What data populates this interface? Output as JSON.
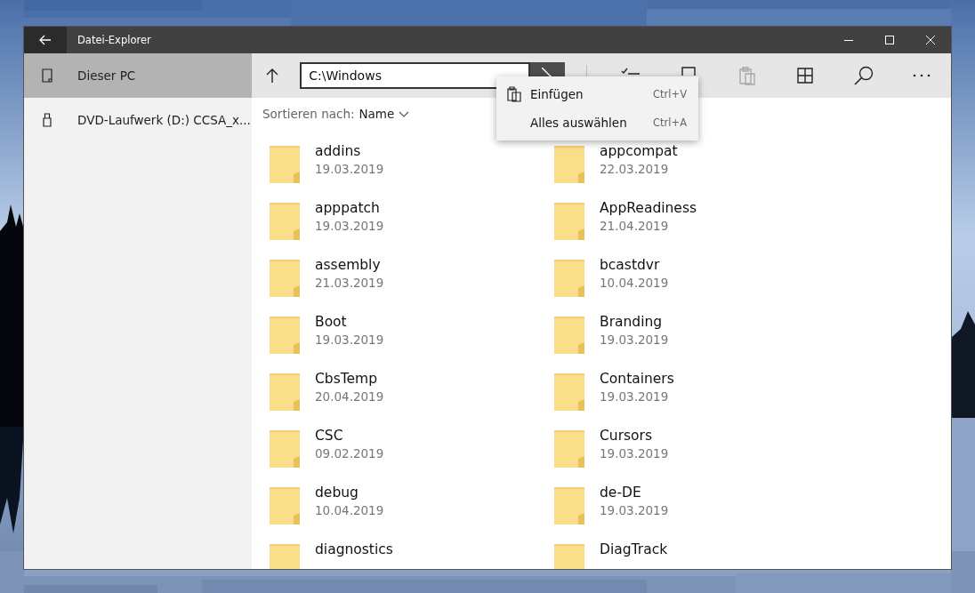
{
  "window": {
    "title": "Datei-Explorer"
  },
  "sidebar": {
    "items": [
      {
        "label": "Dieser PC",
        "kind": "pc",
        "selected": true
      },
      {
        "label": "DVD-Laufwerk (D:) CCSA_x...",
        "kind": "usb",
        "selected": false
      }
    ]
  },
  "address_bar": {
    "value": "C:\\Windows"
  },
  "toolbar": [
    {
      "kind": "select",
      "disabled": false
    },
    {
      "kind": "device",
      "disabled": false
    },
    {
      "kind": "paste",
      "disabled": true
    },
    {
      "kind": "grid",
      "disabled": false
    },
    {
      "kind": "search",
      "disabled": false
    },
    {
      "kind": "more",
      "disabled": false
    }
  ],
  "sort": {
    "label": "Sortieren nach:",
    "value": "Name"
  },
  "context_menu": [
    {
      "label": "Einfügen",
      "shortcut": "Ctrl+V",
      "kind": "paste"
    },
    {
      "label": "Alles auswählen",
      "shortcut": "Ctrl+A",
      "kind": "none"
    }
  ],
  "folders": [
    {
      "name": "addins",
      "date": "19.03.2019"
    },
    {
      "name": "appcompat",
      "date": "22.03.2019"
    },
    {
      "name": "apppatch",
      "date": "19.03.2019"
    },
    {
      "name": "AppReadiness",
      "date": "21.04.2019"
    },
    {
      "name": "assembly",
      "date": "21.03.2019"
    },
    {
      "name": "bcastdvr",
      "date": "10.04.2019"
    },
    {
      "name": "Boot",
      "date": "19.03.2019"
    },
    {
      "name": "Branding",
      "date": "19.03.2019"
    },
    {
      "name": "CbsTemp",
      "date": "20.04.2019"
    },
    {
      "name": "Containers",
      "date": "19.03.2019"
    },
    {
      "name": "CSC",
      "date": "09.02.2019"
    },
    {
      "name": "Cursors",
      "date": "19.03.2019"
    },
    {
      "name": "debug",
      "date": "10.04.2019"
    },
    {
      "name": "de-DE",
      "date": "19.03.2019"
    },
    {
      "name": "diagnostics"
    },
    {
      "name": "DiagTrack"
    }
  ]
}
